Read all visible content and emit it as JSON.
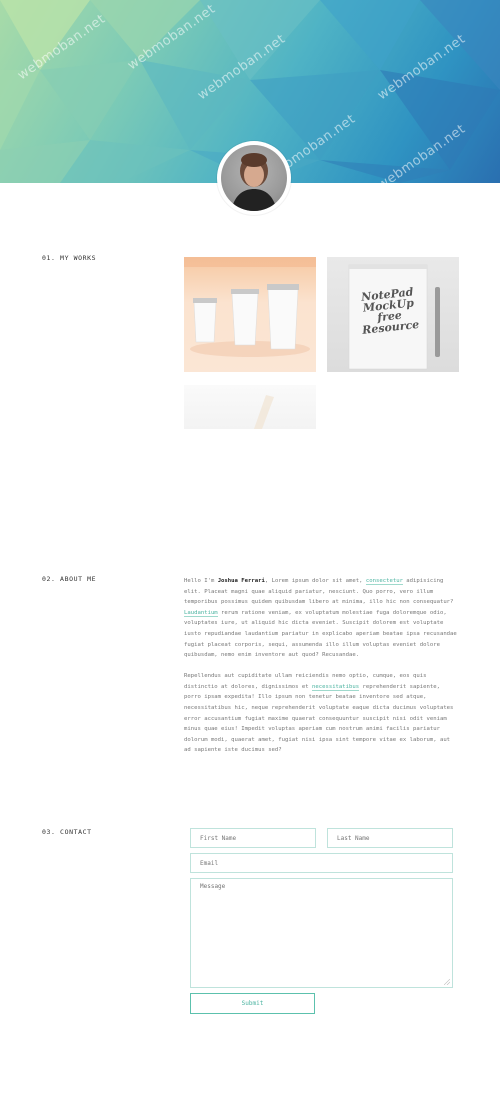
{
  "hero": {
    "watermarks": [
      "webmoban.net",
      "webmoban.net",
      "webmoban.net",
      "webmoban.net",
      "webmoban.net",
      "webmoban.net"
    ]
  },
  "sections": {
    "works_label": "01. MY WORKS",
    "about_label": "02. ABOUT ME",
    "contact_label": "03. CONTACT"
  },
  "works": {
    "notepad_text": [
      "NotePad",
      "MockUp",
      "free",
      "Resource"
    ]
  },
  "about": {
    "p1_intro": "Hello I'm ",
    "p1_name": "Joshua Ferrari",
    "p1_a": ", Lorem ipsum dolor sit amet, ",
    "p1_link1": "consectetur",
    "p1_b": " adipisicing elit. Placeat magni quae aliquid pariatur, nesciunt. Quo porro, vero illum temporibus possimus quidem quibusdam libero at minima, illo hic non consequatur? ",
    "p1_link2": "Laudantium",
    "p1_c": " rerum ratione veniam, ex voluptatum molestiae fuga doloremque odio, voluptates iure, ut aliquid hic dicta eveniet. Suscipit dolorem est voluptate iusto repudiandae laudantium pariatur in explicabo aperiam beatae ipsa recusandae fugiat placeat corporis, sequi, assumenda illo illum voluptas eveniet dolore quibusdam, nemo enim inventore aut quod? Recusandae.",
    "p2_a": "Repellendus aut cupiditate ullam reiciendis nemo optio, cumque, eos quis distinctio at dolores, dignissimos et ",
    "p2_link": "necessitatibus",
    "p2_b": " reprehenderit sapiente, porro ipsam expedita! Illo ipsum non tenetur beatae inventore sed atque, necessitatibus hic, neque reprehenderit voluptate eaque dicta ducimus voluptates error accusantium fugiat maxime quaerat consequuntur suscipit nisi odit veniam minus quae eius! Impedit voluptas aperiam cum nostrum animi facilis pariatur dolorum modi, quaerat amet, fugiat nisi ipsa sint tempore vitae ex laborum, aut ad sapiente iste ducimus sed?"
  },
  "contact": {
    "first_name_placeholder": "First Name",
    "last_name_placeholder": "Last Name",
    "email_placeholder": "Email",
    "message_placeholder": "Message",
    "submit_label": "Submit"
  },
  "colors": {
    "accent": "#4ab3a0",
    "accent_border": "#bfe3dc"
  }
}
